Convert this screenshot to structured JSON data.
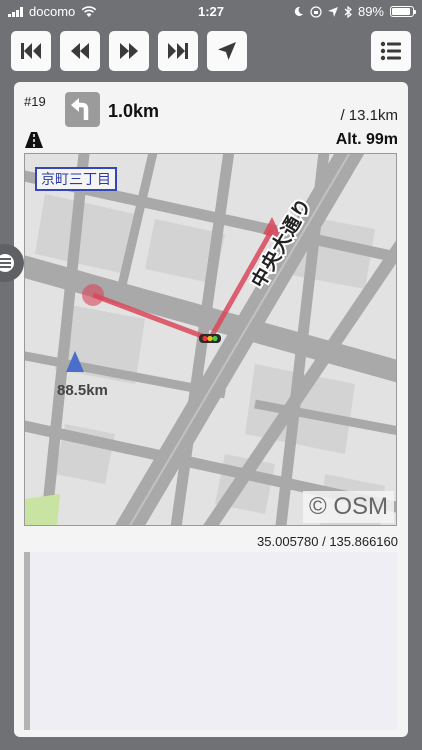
{
  "status_bar": {
    "carrier": "docomo",
    "time": "1:27",
    "battery": "89%",
    "battery_level": 0.89
  },
  "toolbar": {
    "buttons": [
      "skip-to-start",
      "step-back",
      "step-forward",
      "skip-to-end",
      "locate"
    ],
    "menu_icon": "list-icon"
  },
  "route": {
    "step_number": "#19",
    "turn_icon": "turn-left-icon",
    "turn_distance": "1.0km",
    "total_distance": "/ 13.1km",
    "road_icon": "road-icon",
    "altitude": "Alt. 99m"
  },
  "map": {
    "place_label": "京町三丁目",
    "current_distance": "88.5km",
    "road_name": "中央大通り",
    "attribution": "© OSM",
    "coordinates": "35.005780 / 135.866160"
  },
  "colors": {
    "background": "#6f7174",
    "panel": "#f4f4f4",
    "route": "#d9485a",
    "position_marker": "#4a6fc9",
    "label_border": "#3446b8"
  }
}
